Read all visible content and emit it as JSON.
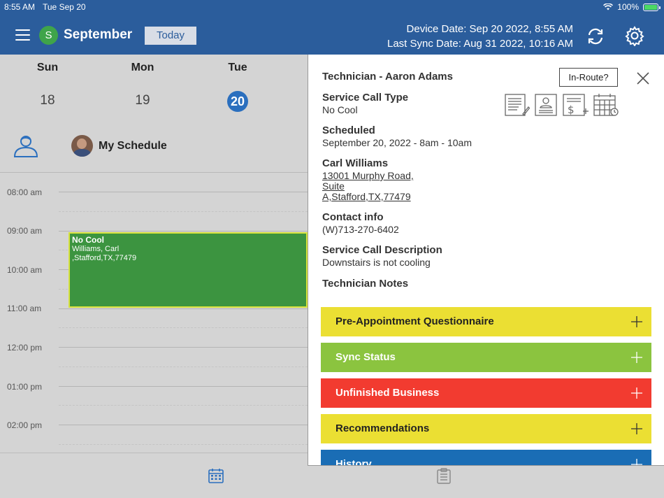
{
  "status_bar": {
    "time": "8:55 AM",
    "date": "Tue Sep 20",
    "battery": "100%"
  },
  "header": {
    "month": "September",
    "avatar_letter": "S",
    "today_label": "Today",
    "device_date": "Device Date: Sep 20 2022, 8:55 AM",
    "last_sync": "Last Sync Date: Aug 31 2022, 10:16 AM"
  },
  "week": {
    "days": [
      {
        "name": "Sun",
        "num": "18"
      },
      {
        "name": "Mon",
        "num": "19"
      },
      {
        "name": "Tue",
        "num": "20"
      }
    ]
  },
  "schedule": {
    "title": "My Schedule",
    "times": [
      "08:00 am",
      "09:00 am",
      "10:00 am",
      "11:00 am",
      "12:00 pm",
      "01:00 pm",
      "02:00 pm"
    ],
    "event": {
      "title": "No Cool",
      "line1": "Williams, Carl",
      "line2": ",Stafford,TX,77479",
      "color": "#3c9440"
    }
  },
  "panel": {
    "technician": "Technician - Aaron Adams",
    "inroute_label": "In-Route?",
    "service_type_label": "Service Call Type",
    "service_type": "No Cool",
    "scheduled_label": "Scheduled",
    "scheduled": "September 20, 2022 - 8am - 10am",
    "customer": "Carl Williams",
    "address_1": "13001 Murphy Road,",
    "address_2": "Suite",
    "address_3": "A,Stafford,TX,77479",
    "contact_label": "Contact info",
    "contact": "(W)713-270-6402",
    "description_label": "Service Call Description",
    "description": "Downstairs is not cooling",
    "notes_label": "Technician Notes",
    "sections": [
      {
        "label": "Pre-Appointment Questionnaire",
        "color": "#ebdf33"
      },
      {
        "label": "Sync Status",
        "color": "#8bc43f"
      },
      {
        "label": "Unfinished Business",
        "color": "#f23b30"
      },
      {
        "label": "Recommendations",
        "color": "#ebdf33"
      },
      {
        "label": "History",
        "color": "#1a6db5"
      }
    ]
  }
}
